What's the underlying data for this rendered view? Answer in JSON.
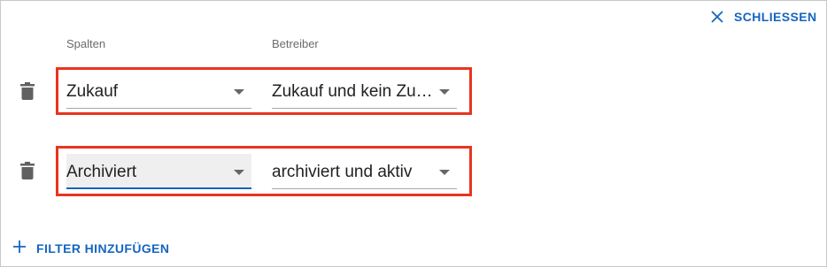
{
  "header": {
    "close_label": "SCHLIESSEN",
    "close_icon": "close-icon"
  },
  "columns": {
    "column_label": "Spalten",
    "operator_label": "Betreiber"
  },
  "filters": [
    {
      "column": "Zukauf",
      "operator": "Zukauf und kein Zu…",
      "delete_icon": "trash-icon"
    },
    {
      "column": "Archiviert",
      "operator": "archiviert und aktiv",
      "delete_icon": "trash-icon"
    }
  ],
  "footer": {
    "add_filter_label": "FILTER HINZUFÜGEN",
    "add_icon": "plus-icon"
  },
  "colors": {
    "accent": "#1565c0",
    "highlight": "#e8351f",
    "focused_bg": "#efefef"
  }
}
